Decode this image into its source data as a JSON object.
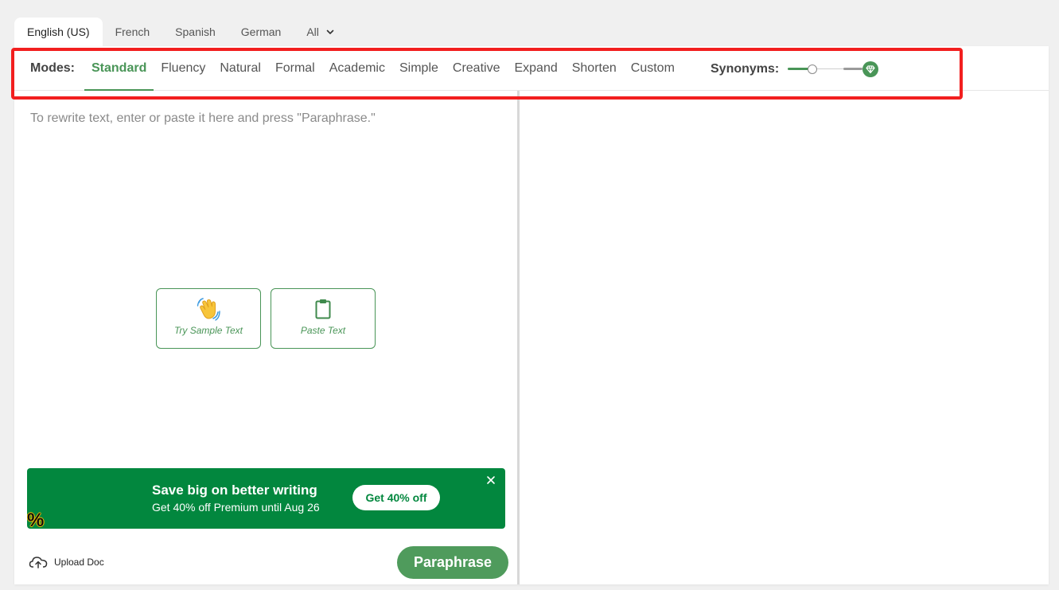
{
  "language_tabs": {
    "items": [
      {
        "label": "English (US)",
        "active": true
      },
      {
        "label": "French",
        "active": false
      },
      {
        "label": "Spanish",
        "active": false
      },
      {
        "label": "German",
        "active": false
      }
    ],
    "all_label": "All"
  },
  "modes": {
    "label": "Modes:",
    "items": [
      {
        "label": "Standard",
        "active": true
      },
      {
        "label": "Fluency",
        "active": false
      },
      {
        "label": "Natural",
        "active": false
      },
      {
        "label": "Formal",
        "active": false
      },
      {
        "label": "Academic",
        "active": false
      },
      {
        "label": "Simple",
        "active": false
      },
      {
        "label": "Creative",
        "active": false
      },
      {
        "label": "Expand",
        "active": false
      },
      {
        "label": "Shorten",
        "active": false
      },
      {
        "label": "Custom",
        "active": false
      }
    ]
  },
  "synonyms": {
    "label": "Synonyms:",
    "level": 0.33,
    "premium_icon": "diamond-icon"
  },
  "input": {
    "placeholder": "To rewrite text, enter or paste it here and press \"Paraphrase.\""
  },
  "actions": {
    "sample_label": "Try Sample Text",
    "sample_icon": "waving-hand-icon",
    "paste_label": "Paste Text",
    "paste_icon": "clipboard-icon"
  },
  "promo": {
    "title": "Save big on better writing",
    "subtitle": "Get 40% off Premium until Aug 26",
    "cta": "Get 40% off",
    "badge": "%"
  },
  "footer": {
    "upload_label": "Upload Doc",
    "paraphrase_label": "Paraphrase"
  },
  "colors": {
    "accent": "#499557",
    "promo_bg": "#02873e",
    "highlight": "#f21f1f",
    "button": "#4f9b5c"
  }
}
